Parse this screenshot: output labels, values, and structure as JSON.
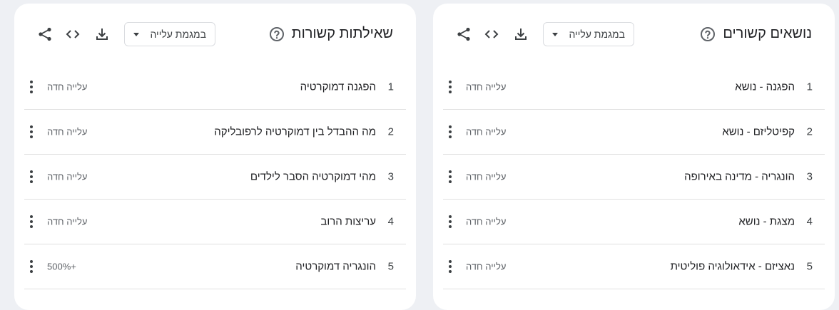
{
  "cards": [
    {
      "id": "related-topics",
      "title": "נושאים קשורים",
      "filter": "במגמת עלייה",
      "icons": [
        "help-icon",
        "download-icon",
        "embed-icon",
        "share-icon"
      ],
      "rows": [
        {
          "rank": "1",
          "label": "הפגנה - נושא",
          "value": "עלייה חדה"
        },
        {
          "rank": "2",
          "label": "קפיטליזם - נושא",
          "value": "עלייה חדה"
        },
        {
          "rank": "3",
          "label": "הונגריה - מדינה באירופה",
          "value": "עלייה חדה"
        },
        {
          "rank": "4",
          "label": "מצגת - נושא",
          "value": "עלייה חדה"
        },
        {
          "rank": "5",
          "label": "נאציזם - אידאולוגיה פוליטית",
          "value": "עלייה חדה"
        }
      ]
    },
    {
      "id": "related-queries",
      "title": "שאילתות קשורות",
      "filter": "במגמת עלייה",
      "icons": [
        "help-icon",
        "download-icon",
        "embed-icon",
        "share-icon"
      ],
      "rows": [
        {
          "rank": "1",
          "label": "הפגנה דמוקרטיה",
          "value": "עלייה חדה"
        },
        {
          "rank": "2",
          "label": "מה ההבדל בין דמוקרטיה לרפובליקה",
          "value": "עלייה חדה"
        },
        {
          "rank": "3",
          "label": "מהי דמוקרטיה הסבר לילדים",
          "value": "עלייה חדה"
        },
        {
          "rank": "4",
          "label": "עריצות הרוב",
          "value": "עלייה חדה"
        },
        {
          "rank": "5",
          "label": "הונגריה דמוקרטיה",
          "value": "500%+"
        }
      ]
    }
  ]
}
